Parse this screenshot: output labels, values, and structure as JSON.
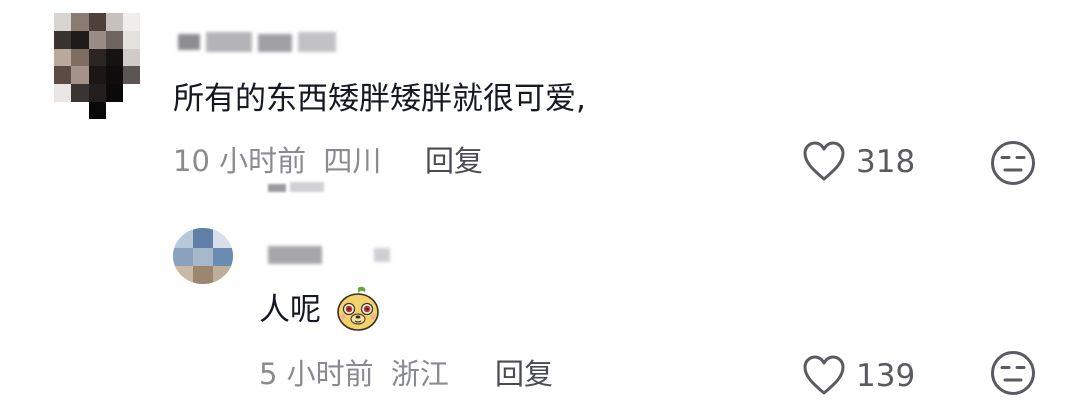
{
  "comments": [
    {
      "avatar_icon": "pixelated-avatar",
      "username_icon": "blurred-username",
      "text": "所有的东西矮胖矮胖就很可爱,",
      "time": "10 小时前",
      "location": "四川",
      "reply_label": "回复",
      "like_icon": "heart-outline-icon",
      "like_count": "318",
      "dislike_icon": "neutral-face-icon"
    },
    {
      "avatar_icon": "pixelated-avatar",
      "username_icon": "blurred-username",
      "text": "人呢",
      "sticker_icon": "yellow-dog-emoji-sticker",
      "time": "5 小时前",
      "location": "浙江",
      "reply_label": "回复",
      "like_icon": "heart-outline-icon",
      "like_count": "139",
      "dislike_icon": "neutral-face-icon"
    }
  ],
  "colors": {
    "primary_text": "#161823",
    "meta_text": "#8a8b91",
    "icon_gray": "#5a5b61"
  }
}
